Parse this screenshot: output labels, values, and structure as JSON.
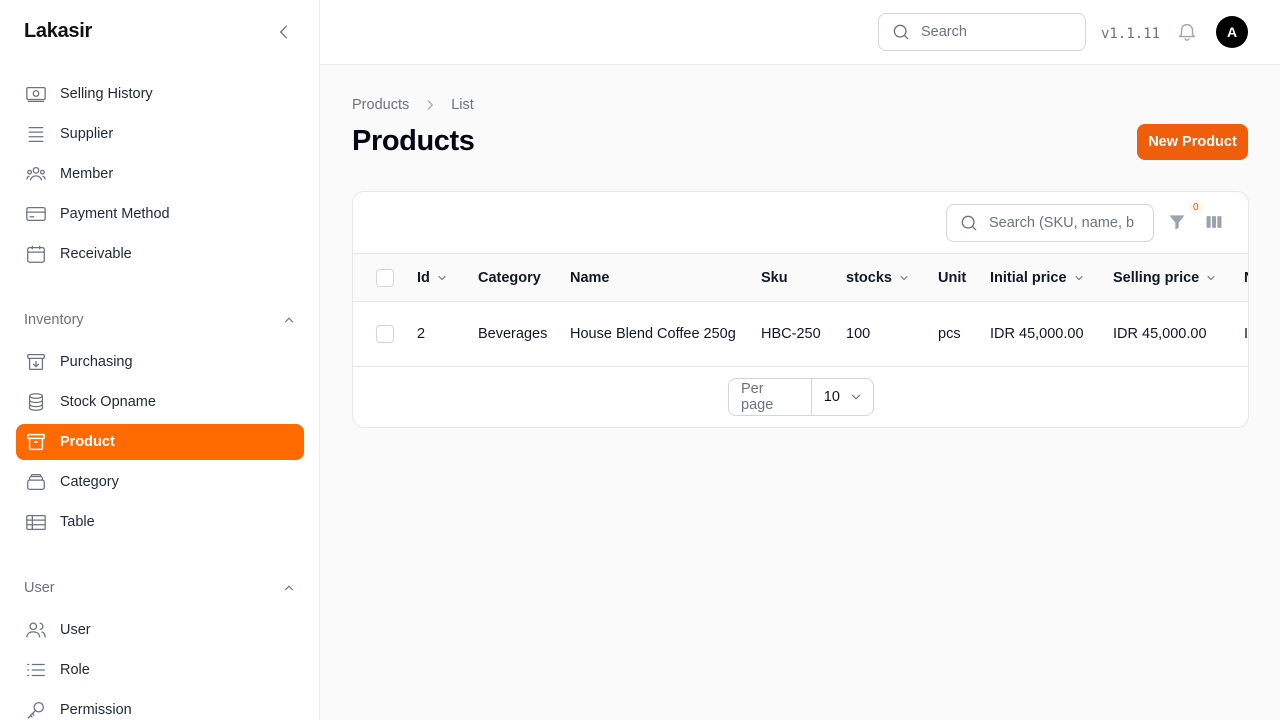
{
  "app": {
    "brand": "Lakasir",
    "version": "v1.1.11",
    "avatar_initial": "A",
    "accent": "#ff6a00"
  },
  "topbar": {
    "search_placeholder": "Search"
  },
  "sidebar": {
    "items_top": [
      {
        "label": "Selling History",
        "icon": "money-icon"
      },
      {
        "label": "Supplier",
        "icon": "server-stack-icon"
      },
      {
        "label": "Member",
        "icon": "user-group-icon"
      },
      {
        "label": "Payment Method",
        "icon": "credit-card-icon"
      },
      {
        "label": "Receivable",
        "icon": "calendar-icon"
      }
    ],
    "inventory_group": "Inventory",
    "inventory_items": [
      {
        "label": "Purchasing",
        "icon": "archive-down-icon"
      },
      {
        "label": "Stock Opname",
        "icon": "database-icon"
      },
      {
        "label": "Product",
        "icon": "archive-box-icon"
      },
      {
        "label": "Category",
        "icon": "stack-icon"
      },
      {
        "label": "Table",
        "icon": "table-icon"
      }
    ],
    "user_group": "User",
    "user_items": [
      {
        "label": "User",
        "icon": "users-icon"
      },
      {
        "label": "Role",
        "icon": "list-icon"
      },
      {
        "label": "Permission",
        "icon": "key-icon"
      }
    ]
  },
  "main": {
    "breadcrumb": [
      "Products",
      "List"
    ],
    "title": "Products",
    "new_button": "New Product",
    "table": {
      "search_placeholder": "Search (SKU, name, b",
      "filter_count": "0",
      "columns": [
        "Id",
        "Category",
        "Name",
        "Sku",
        "stocks",
        "Unit",
        "Initial price",
        "Selling price",
        "N"
      ],
      "rows": [
        [
          "2",
          "Beverages",
          "House Blend Coffee 250g",
          "HBC-250",
          "100",
          "pcs",
          "IDR 45,000.00",
          "IDR 45,000.00",
          "I"
        ]
      ],
      "per_page_label": "Per page",
      "per_page_value": "10"
    }
  }
}
